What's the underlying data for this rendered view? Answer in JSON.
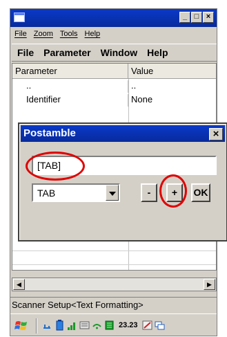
{
  "main_window": {
    "title": "",
    "buttons": [
      "_",
      "□",
      "×"
    ]
  },
  "menubar_top": [
    "File",
    "Zoom",
    "Tools",
    "Help"
  ],
  "menubar_app": [
    "File",
    "Parameter",
    "Window",
    "Help"
  ],
  "grid": {
    "headers": [
      "Parameter",
      "Value"
    ],
    "rows": [
      {
        "parameter": "..",
        "value": ".."
      },
      {
        "parameter": "Identifier",
        "value": "None"
      }
    ]
  },
  "scrollbar": {
    "left_arrow": "◀",
    "right_arrow": "▶"
  },
  "statusbar": {
    "text": "Scanner Setup<Text Formatting>"
  },
  "taskbar": {
    "clock": "23.23"
  },
  "dialog": {
    "title": "Postamble",
    "close": "×",
    "text_value": "[TAB]",
    "combo_value": "TAB",
    "minus_label": "-",
    "plus_label": "+",
    "ok_label": "OK"
  },
  "colors": {
    "titlebar": "#0a3ac8",
    "window_face": "#d4d0c8",
    "highlight_circle": "#e00000"
  }
}
